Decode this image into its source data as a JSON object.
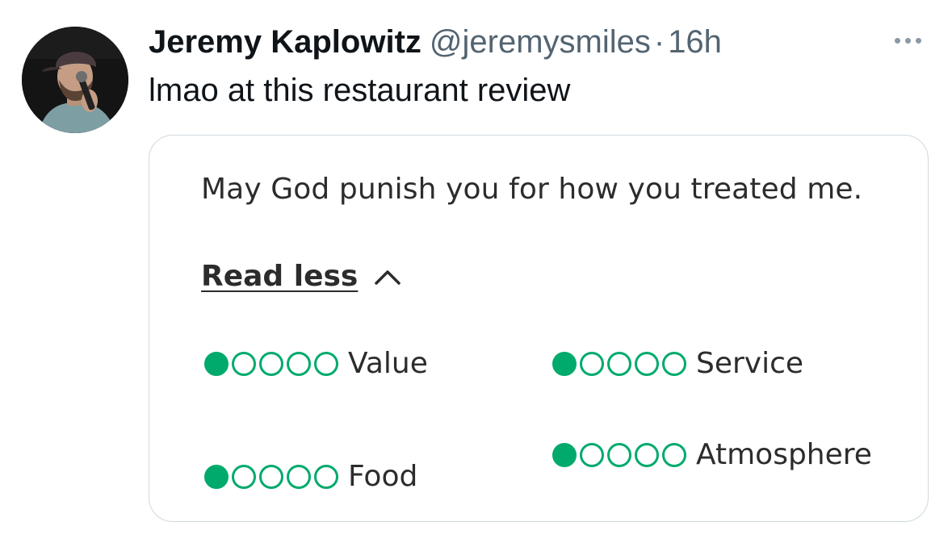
{
  "tweet": {
    "author": {
      "display_name": "Jeremy Kaplowitz",
      "handle": "@jeremysmiles",
      "separator": "·",
      "timestamp": "16h"
    },
    "text": "lmao at this restaurant review",
    "more_icon": "more-horizontal-icon"
  },
  "review_card": {
    "text": "May God punish you for how you treated me.",
    "read_less_label": "Read less",
    "read_less_icon": "chevron-up-icon",
    "bubble_color": "#00aa6c",
    "ratings": [
      {
        "label": "Value",
        "score": 1,
        "max": 5
      },
      {
        "label": "Service",
        "score": 1,
        "max": 5
      },
      {
        "label": "Food",
        "score": 1,
        "max": 5
      },
      {
        "label": "Atmosphere",
        "score": 1,
        "max": 5
      }
    ]
  }
}
